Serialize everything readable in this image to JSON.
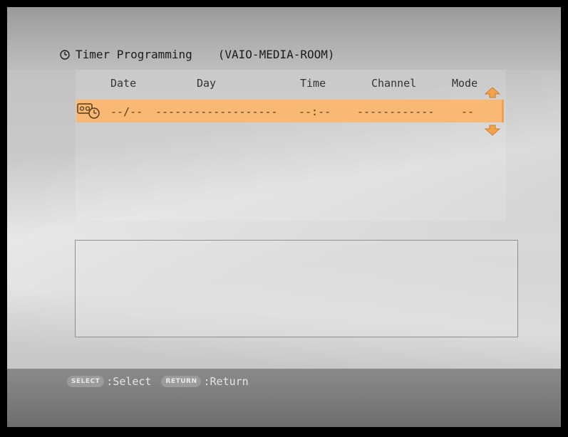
{
  "title": {
    "label": "Timer Programming",
    "host": "(VAIO-MEDIA-ROOM)"
  },
  "columns": {
    "date": "Date",
    "day": "Day",
    "time": "Time",
    "channel": "Channel",
    "mode": "Mode"
  },
  "rows": [
    {
      "date": "--/--",
      "day": "-------------------",
      "time": "--:--",
      "channel": "------------",
      "mode": "--"
    }
  ],
  "icons": {
    "title": "clock-icon",
    "row": "vcr-timer-icon",
    "scroll_up": "arrow-up-icon",
    "scroll_down": "arrow-down-icon"
  },
  "colors": {
    "selected_row": "#f9b874",
    "arrow": "#f3a24a"
  },
  "hints": [
    {
      "key": "SELECT",
      "label": ":Select"
    },
    {
      "key": "RETURN",
      "label": ":Return"
    }
  ]
}
